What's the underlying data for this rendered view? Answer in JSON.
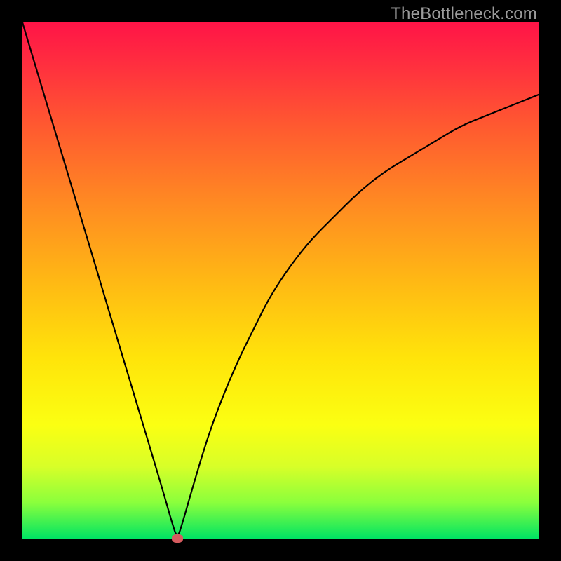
{
  "watermark": "TheBottleneck.com",
  "colors": {
    "frame_bg": "#000000",
    "gradient_top": "#ff1447",
    "gradient_mid1": "#ff8a22",
    "gradient_mid2": "#ffe40a",
    "gradient_bottom": "#00e463",
    "curve_stroke": "#000000",
    "marker_fill": "#d65b5f",
    "watermark_color": "#9b9b9b"
  },
  "chart_data": {
    "type": "line",
    "title": "",
    "xlabel": "",
    "ylabel": "",
    "xlim": [
      0,
      100
    ],
    "ylim": [
      0,
      100
    ],
    "x": [
      0,
      3,
      6,
      9,
      12,
      15,
      18,
      21,
      24,
      27,
      29,
      30,
      31,
      33,
      36,
      39,
      42,
      45,
      48,
      52,
      56,
      60,
      65,
      70,
      75,
      80,
      85,
      90,
      95,
      100
    ],
    "values": [
      100,
      90,
      80,
      70,
      60,
      50,
      40,
      30,
      20,
      10,
      3,
      0,
      3,
      10,
      20,
      28,
      35,
      41,
      47,
      53,
      58,
      62,
      67,
      71,
      74,
      77,
      80,
      82,
      84,
      86
    ],
    "marker": {
      "x": 30,
      "y": 0
    },
    "notes": "V-shaped curve: steep linear descent on left arm, sub-linear rise on right arm toward an asymptote around 86%. Minimum (0) at x≈30. Values estimated from gridless gradient plot."
  }
}
